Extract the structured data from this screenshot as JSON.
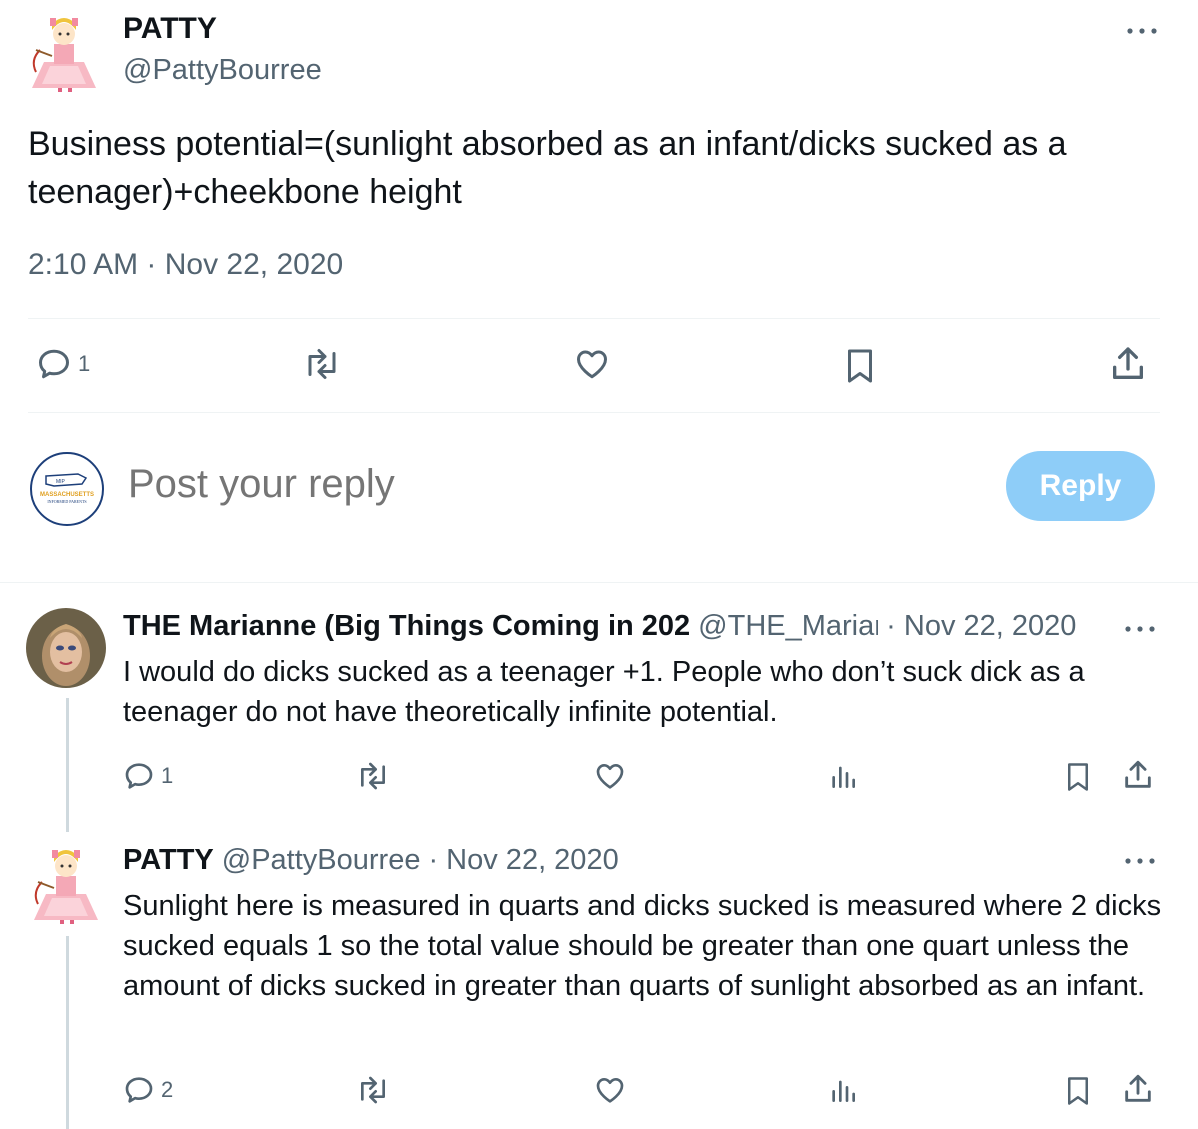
{
  "main_tweet": {
    "name": "PATTY",
    "handle": "@PattyBourree",
    "text": "Business potential=(sunlight absorbed as an infant/dicks sucked as a teenager)+cheekbone height",
    "timestamp": "2:10 AM · Nov 22, 2020",
    "actions": {
      "reply_count": "1",
      "icons": [
        "reply-icon",
        "retweet-icon",
        "like-icon",
        "bookmark-icon",
        "share-icon"
      ]
    }
  },
  "reply_box": {
    "placeholder": "Post your reply",
    "button_label": "Reply",
    "button_color": "#8ecdf8",
    "avatar_text": {
      "line1": "MASSACHUSETTS",
      "line2": "INFORMED PARENTS"
    }
  },
  "replies": [
    {
      "name": "THE Marianne (Big Things Coming in 202",
      "handle": "@THE_Mariar",
      "date": "· Nov 22, 2020",
      "text": "I would do dicks sucked as a teenager +1. People who don’t suck dick as a teenager do not have theoretically infinite potential.",
      "reply_count": "1"
    },
    {
      "name": "PATTY",
      "handle": "@PattyBourree",
      "date": "· Nov 22, 2020",
      "text": "Sunlight here is measured in quarts and dicks sucked is measured where 2 dicks sucked equals 1 so the total value should be greater than one quart unless the amount of dicks sucked in greater than quarts of sunlight absorbed as an infant.",
      "reply_count": "2"
    }
  ],
  "colors": {
    "text": "#0f1419",
    "muted": "#536471",
    "divider": "#eff3f4",
    "thread_line": "#cfd9de"
  }
}
